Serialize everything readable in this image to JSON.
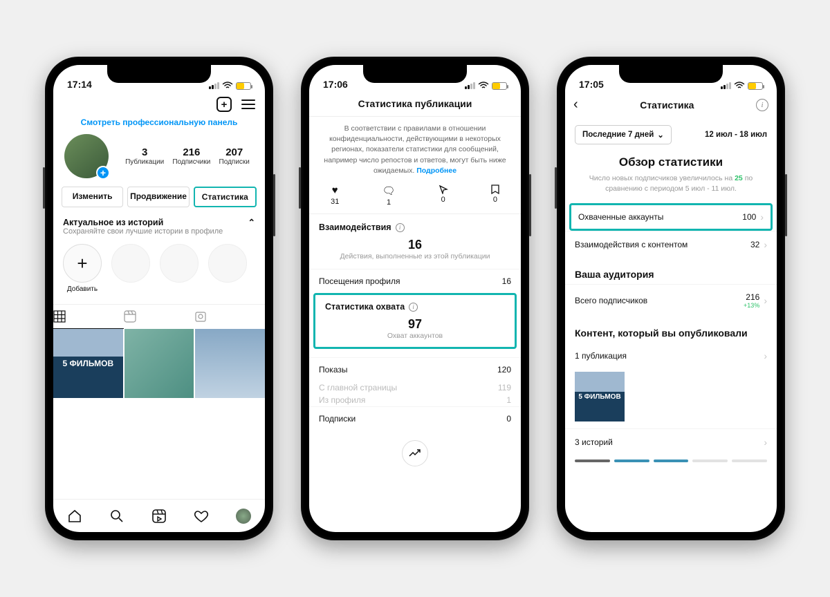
{
  "colors": {
    "accent_link": "#0095f6",
    "highlight": "#12b5b0",
    "positive": "#2ec26a",
    "battery": "#ffcc00"
  },
  "phone1": {
    "time": "17:14",
    "pro_panel_link": "Смотреть профессиональную панель",
    "stats": [
      {
        "n": "3",
        "l": "Публикации"
      },
      {
        "n": "216",
        "l": "Подписчики"
      },
      {
        "n": "207",
        "l": "Подписки"
      }
    ],
    "buttons": {
      "edit": "Изменить",
      "promo": "Продвижение",
      "stats": "Статистика"
    },
    "highlights": {
      "title": "Актуальное из историй",
      "sub": "Сохраняйте свои лучшие истории в профиле",
      "add": "Добавить"
    },
    "post_caption": "5 ФИЛЬМОВ"
  },
  "phone2": {
    "time": "17:06",
    "title": "Статистика публикации",
    "notice": "В соответствии с правилами в отношении конфиденциальности, действующими в некоторых регионах, показатели статистики для сообщений, например число репостов и ответов, могут быть ниже ожидаемых.",
    "notice_link": "Подробнее",
    "engagement": [
      {
        "icon": "heart",
        "value": "31"
      },
      {
        "icon": "comment",
        "value": "1"
      },
      {
        "icon": "share",
        "value": "0"
      },
      {
        "icon": "save",
        "value": "0"
      }
    ],
    "interactions": {
      "title": "Взаимодействия",
      "value": "16",
      "sub": "Действия, выполненные из этой публикации"
    },
    "profile_visits": {
      "label": "Посещения профиля",
      "value": "16"
    },
    "reach": {
      "title": "Статистика охвата",
      "value": "97",
      "sub": "Охват аккаунтов"
    },
    "impressions": {
      "label": "Показы",
      "value": "120"
    },
    "impressions_breakdown": [
      {
        "label": "С главной страницы",
        "value": "119"
      },
      {
        "label": "Из профиля",
        "value": "1"
      }
    ],
    "follows": {
      "label": "Подписки",
      "value": "0"
    }
  },
  "phone3": {
    "time": "17:05",
    "title": "Статистика",
    "range_label": "Последние 7 дней",
    "range_dates": "12 июл - 18 июл",
    "h2": "Обзор статистики",
    "h2_sub_pre": "Число новых подписчиков увеличилось на ",
    "h2_sub_num": "25",
    "h2_sub_post": " по сравнению с периодом 5 июл - 11 июл.",
    "reached": {
      "label": "Охваченные аккаунты",
      "value": "100"
    },
    "content_inter": {
      "label": "Взаимодействия с контентом",
      "value": "32"
    },
    "audience": {
      "title": "Ваша аудитория",
      "total_label": "Всего подписчиков",
      "total": "216",
      "change": "+13%"
    },
    "content": {
      "title": "Контент, который вы опубликовали",
      "pubs": "1 публикация",
      "thumb_caption": "5 ФИЛЬМОВ",
      "stories": "3 историй"
    }
  }
}
